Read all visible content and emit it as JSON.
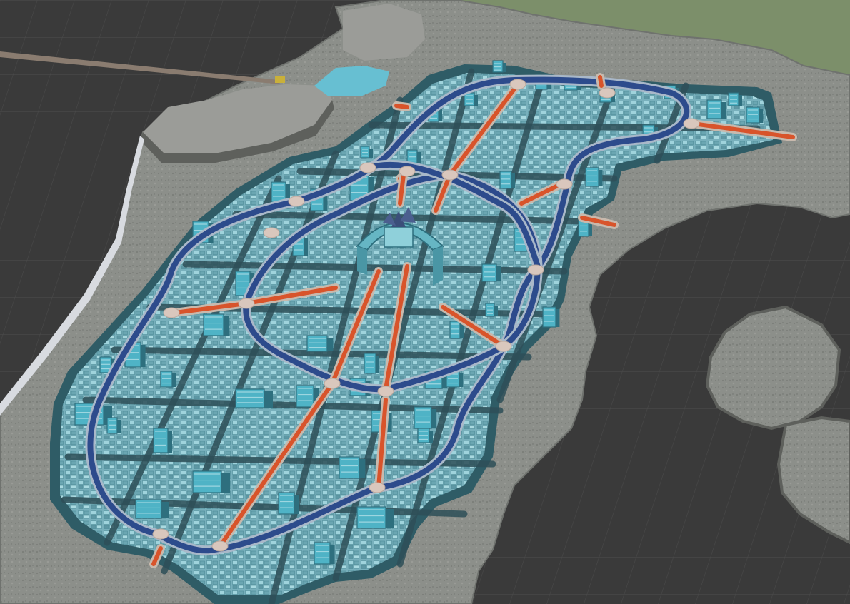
{
  "viewport": {
    "view": "3d-editor-viewport",
    "grid_visible": true
  },
  "colors": {
    "void": "#3a3a3a",
    "grid_line": "#4a4a4a",
    "terrain": "#8c8f8a",
    "terrain_dark": "#6f726e",
    "cliff": "#9b9c98",
    "cliff_shadow": "#5e605c",
    "grass": "#7c8f6a",
    "water": "#67bfd2",
    "city_wall": "#2f5c66",
    "city_floor": "#78b0bc",
    "city_block": "#8fc6d0",
    "street": "#2e4f58",
    "ring_road": "#2d4b8c",
    "ring_road_edge": "#a9b8c9",
    "avenue": "#d8542b",
    "avenue_edge": "#c8b9ad",
    "node": "#d9c7bd",
    "building": "#4fb3c6",
    "building_dark": "#2e6f7e",
    "palace": "#66b6c4",
    "bridge": "#8a7c70"
  },
  "scene": {
    "objects": [
      "terrain-island",
      "north-cliff",
      "grass-ridge",
      "east-islet",
      "water-inlet",
      "bridge",
      "walled-city",
      "central-palace",
      "ring-roads",
      "radial-avenues",
      "street-grid",
      "city-buildings"
    ]
  }
}
